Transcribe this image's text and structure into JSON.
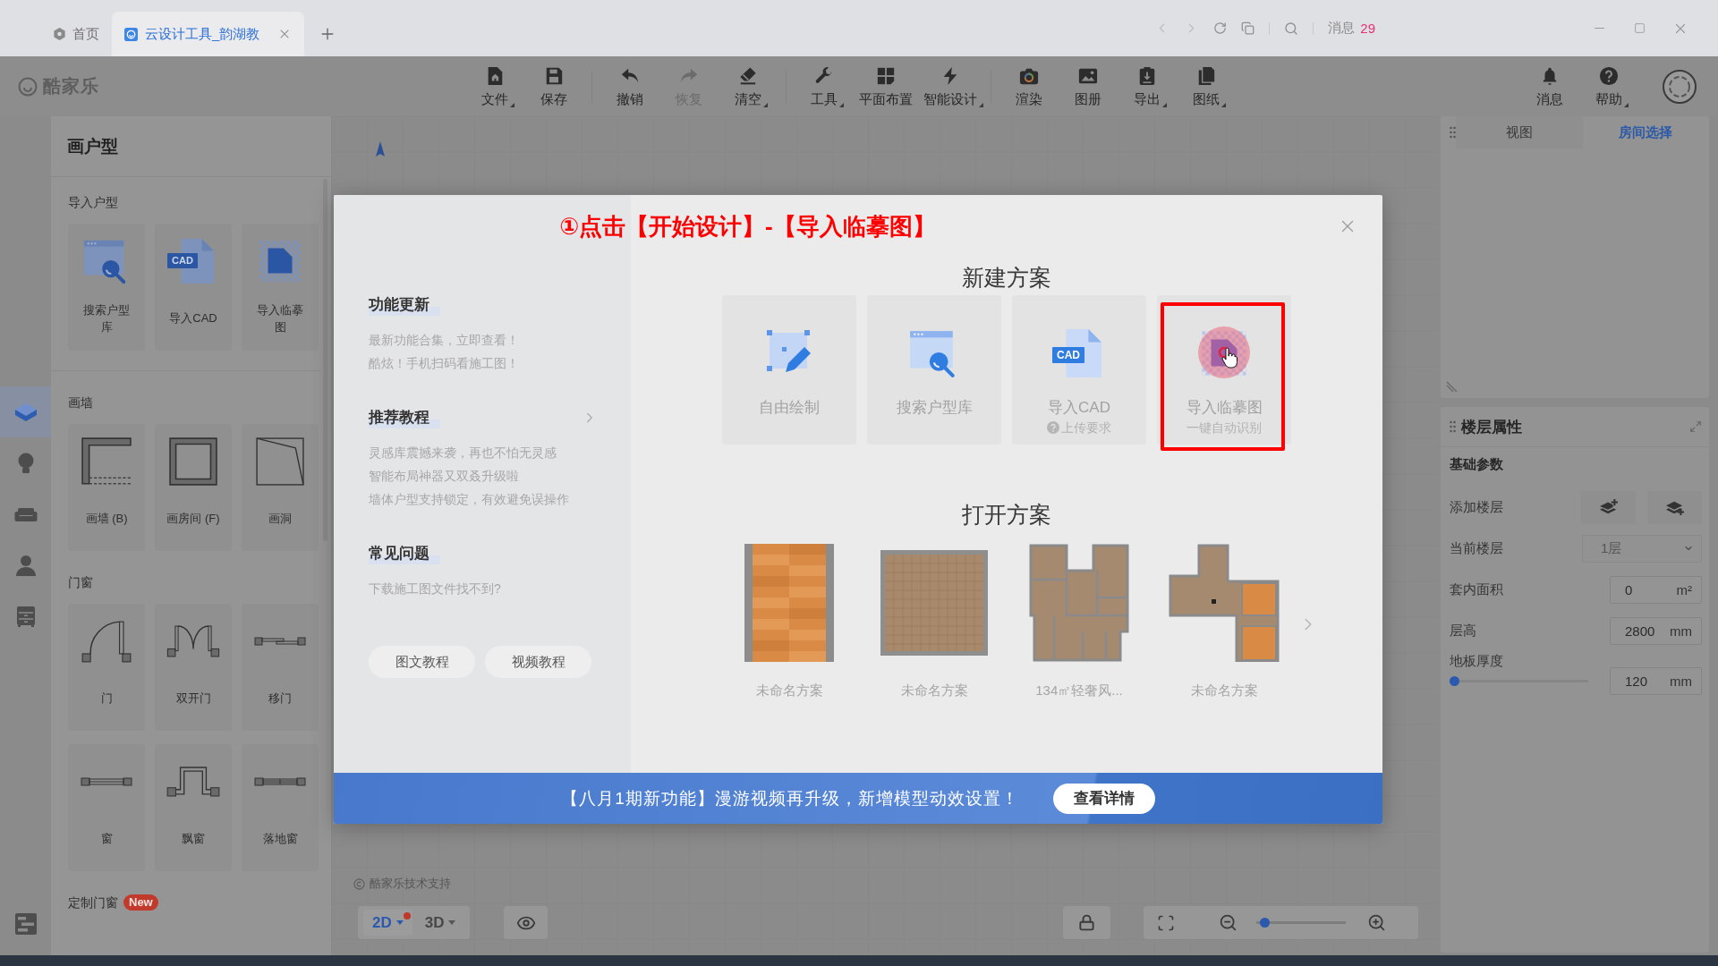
{
  "browser": {
    "tabs": [
      {
        "label": "首页",
        "selected": false
      },
      {
        "label": "云设计工具_韵湖教",
        "selected": true
      }
    ],
    "messages": {
      "label": "消息",
      "count": "29"
    }
  },
  "toolbar": {
    "logo": "酷家乐",
    "groups": [
      [
        {
          "label": "文件",
          "menu": true,
          "disabled": false
        },
        {
          "label": "保存",
          "menu": false,
          "disabled": false
        }
      ],
      [
        {
          "label": "撤销",
          "menu": false,
          "disabled": false
        },
        {
          "label": "恢复",
          "menu": false,
          "disabled": true
        },
        {
          "label": "清空",
          "menu": true,
          "disabled": false
        }
      ],
      [
        {
          "label": "工具",
          "menu": true,
          "disabled": false
        },
        {
          "label": "平面布置",
          "menu": false,
          "disabled": false
        },
        {
          "label": "智能设计",
          "menu": true,
          "disabled": false
        }
      ],
      [
        {
          "label": "渲染",
          "menu": false,
          "disabled": false
        },
        {
          "label": "图册",
          "menu": false,
          "disabled": false
        },
        {
          "label": "导出",
          "menu": true,
          "disabled": false
        },
        {
          "label": "图纸",
          "menu": true,
          "disabled": false
        }
      ]
    ],
    "right": [
      {
        "label": "消息",
        "menu": false
      },
      {
        "label": "帮助",
        "menu": true
      }
    ]
  },
  "side_nav": [
    {
      "selected": true
    },
    {
      "selected": false
    },
    {
      "selected": false
    },
    {
      "selected": false
    },
    {
      "selected": false
    }
  ],
  "panel": {
    "title": "画户型",
    "sections": [
      {
        "title": "导入户型",
        "items": [
          {
            "label": "搜索户型库"
          },
          {
            "label": "导入CAD",
            "icon_text": "CAD"
          },
          {
            "label": "导入临摹图"
          }
        ]
      },
      {
        "title": "画墙",
        "items": [
          {
            "label": "画墙 (B)"
          },
          {
            "label": "画房间 (F)"
          },
          {
            "label": "画洞"
          }
        ]
      },
      {
        "title": "门窗",
        "items": [
          {
            "label": "门"
          },
          {
            "label": "双开门"
          },
          {
            "label": "移门"
          },
          {
            "label": "窗"
          },
          {
            "label": "飘窗"
          },
          {
            "label": "落地窗"
          }
        ]
      },
      {
        "title": "定制门窗",
        "badge": "New"
      }
    ]
  },
  "canvas": {
    "support_text": "酷家乐技术支持",
    "view_modes": [
      {
        "label": "2D",
        "selected": true,
        "dot": true
      },
      {
        "label": "3D",
        "selected": false,
        "dot": false
      }
    ],
    "zoom": {
      "level": 0.05
    }
  },
  "inspector": {
    "tabs": [
      {
        "label": "视图",
        "selected": false
      },
      {
        "label": "房间选择",
        "selected": true
      }
    ],
    "title": "楼层属性",
    "section": "基础参数",
    "rows": [
      {
        "kind": "buttons",
        "label": "添加楼层"
      },
      {
        "kind": "select",
        "label": "当前楼层",
        "value": "1层",
        "disabled": true
      },
      {
        "kind": "input",
        "label": "套内面积",
        "value": "0",
        "unit": "m²"
      },
      {
        "kind": "input",
        "label": "层高",
        "value": "2800",
        "unit": "mm"
      },
      {
        "kind": "slider",
        "label": "地板厚度",
        "level": 0,
        "value": "120",
        "unit": "mm"
      }
    ]
  },
  "modal": {
    "annotation": "①点击【开始设计】-【导入临摹图】",
    "news": [
      {
        "title": "功能更新",
        "more": false,
        "lines": [
          "最新功能合集，立即查看！",
          "酷炫！手机扫码看施工图！"
        ]
      },
      {
        "title": "推荐教程",
        "more": true,
        "lines": [
          "灵感库震撼来袭，再也不怕无灵感",
          "智能布局神器又双叒升级啦",
          "墙体户型支持锁定，有效避免误操作"
        ]
      },
      {
        "title": "常见问题",
        "more": false,
        "lines": [
          "下载施工图文件找不到?"
        ]
      }
    ],
    "tutorials": [
      "图文教程",
      "视频教程"
    ],
    "new_plan": {
      "title": "新建方案",
      "options": [
        {
          "label": "自由绘制",
          "highlighted": false
        },
        {
          "label": "搜索户型库",
          "highlighted": false
        },
        {
          "label": "导入CAD",
          "icon_text": "CAD",
          "hint": "上传要求",
          "hint_help": true,
          "highlighted": false
        },
        {
          "label": "导入临摹图",
          "hint": "一键自动识别",
          "hint_help": false,
          "highlighted": true
        }
      ]
    },
    "open_plan": {
      "title": "打开方案",
      "plans": [
        "未命名方案",
        "未命名方案",
        "134㎡轻奢风...",
        "未命名方案"
      ]
    },
    "banner": {
      "text": "【八月1期新功能】漫游视频再升级，新增模型动效设置！",
      "button": "查看详情"
    }
  }
}
